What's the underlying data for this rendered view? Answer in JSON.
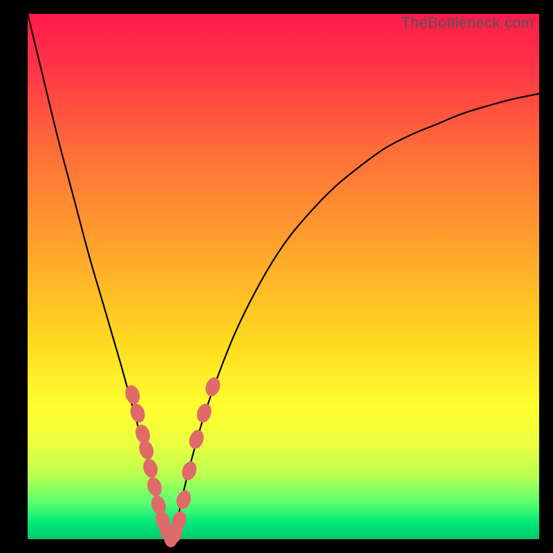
{
  "watermark": "TheBottleneck.com",
  "colors": {
    "gradient_top": "#ff1a4d",
    "gradient_bottom": "#00c86a",
    "curve": "#000000",
    "marker": "#e06a6a",
    "frame": "#000000"
  },
  "chart_data": {
    "type": "line",
    "title": "",
    "xlabel": "",
    "ylabel": "",
    "xlim": [
      0,
      100
    ],
    "ylim": [
      0,
      100
    ],
    "grid": false,
    "legend": false,
    "series": [
      {
        "name": "bottleneck-curve",
        "x": [
          0,
          3,
          6,
          9,
          12,
          15,
          18,
          20,
          22,
          24,
          25,
          26,
          27,
          28,
          29,
          30,
          32,
          35,
          40,
          45,
          50,
          55,
          60,
          65,
          70,
          75,
          80,
          85,
          90,
          95,
          100
        ],
        "y": [
          100,
          88,
          76,
          65,
          54,
          44,
          34,
          27,
          20,
          13,
          9,
          5,
          2,
          0,
          2,
          7,
          15,
          25,
          38,
          48,
          56,
          62,
          67,
          71,
          74.5,
          77,
          79,
          81,
          82.5,
          83.8,
          84.8
        ]
      }
    ],
    "markers": [
      {
        "x": 20.5,
        "y": 27.5
      },
      {
        "x": 21.5,
        "y": 24
      },
      {
        "x": 22.5,
        "y": 20
      },
      {
        "x": 23.2,
        "y": 17
      },
      {
        "x": 24.0,
        "y": 13.5
      },
      {
        "x": 24.8,
        "y": 10
      },
      {
        "x": 25.6,
        "y": 6.5
      },
      {
        "x": 26.4,
        "y": 3.5
      },
      {
        "x": 27.2,
        "y": 1.5
      },
      {
        "x": 28.0,
        "y": 0.3
      },
      {
        "x": 28.8,
        "y": 1.0
      },
      {
        "x": 29.6,
        "y": 3.5
      },
      {
        "x": 30.5,
        "y": 7.5
      },
      {
        "x": 31.6,
        "y": 13
      },
      {
        "x": 33.0,
        "y": 19
      },
      {
        "x": 34.5,
        "y": 24
      },
      {
        "x": 36.2,
        "y": 29
      }
    ]
  }
}
